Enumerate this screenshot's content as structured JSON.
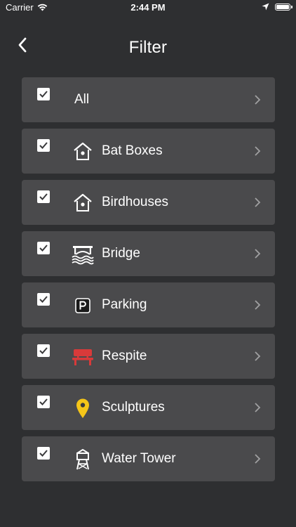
{
  "status_bar": {
    "carrier": "Carrier",
    "time": "2:44 PM"
  },
  "nav": {
    "title": "Filter",
    "back_icon": "chevron-left-icon"
  },
  "filters": [
    {
      "label": "All",
      "checked": true,
      "icon": null
    },
    {
      "label": "Bat Boxes",
      "checked": true,
      "icon": "birdhouse-icon"
    },
    {
      "label": "Birdhouses",
      "checked": true,
      "icon": "birdhouse-icon"
    },
    {
      "label": "Bridge",
      "checked": true,
      "icon": "bridge-icon"
    },
    {
      "label": "Parking",
      "checked": true,
      "icon": "parking-icon"
    },
    {
      "label": "Respite",
      "checked": true,
      "icon": "bench-icon"
    },
    {
      "label": "Sculptures",
      "checked": true,
      "icon": "map-pin-icon"
    },
    {
      "label": "Water Tower",
      "checked": true,
      "icon": "water-tower-icon"
    }
  ],
  "colors": {
    "background": "#2e2f31",
    "row": "#4a4a4c",
    "bench": "#d83a3a",
    "pin": "#f5c518"
  }
}
